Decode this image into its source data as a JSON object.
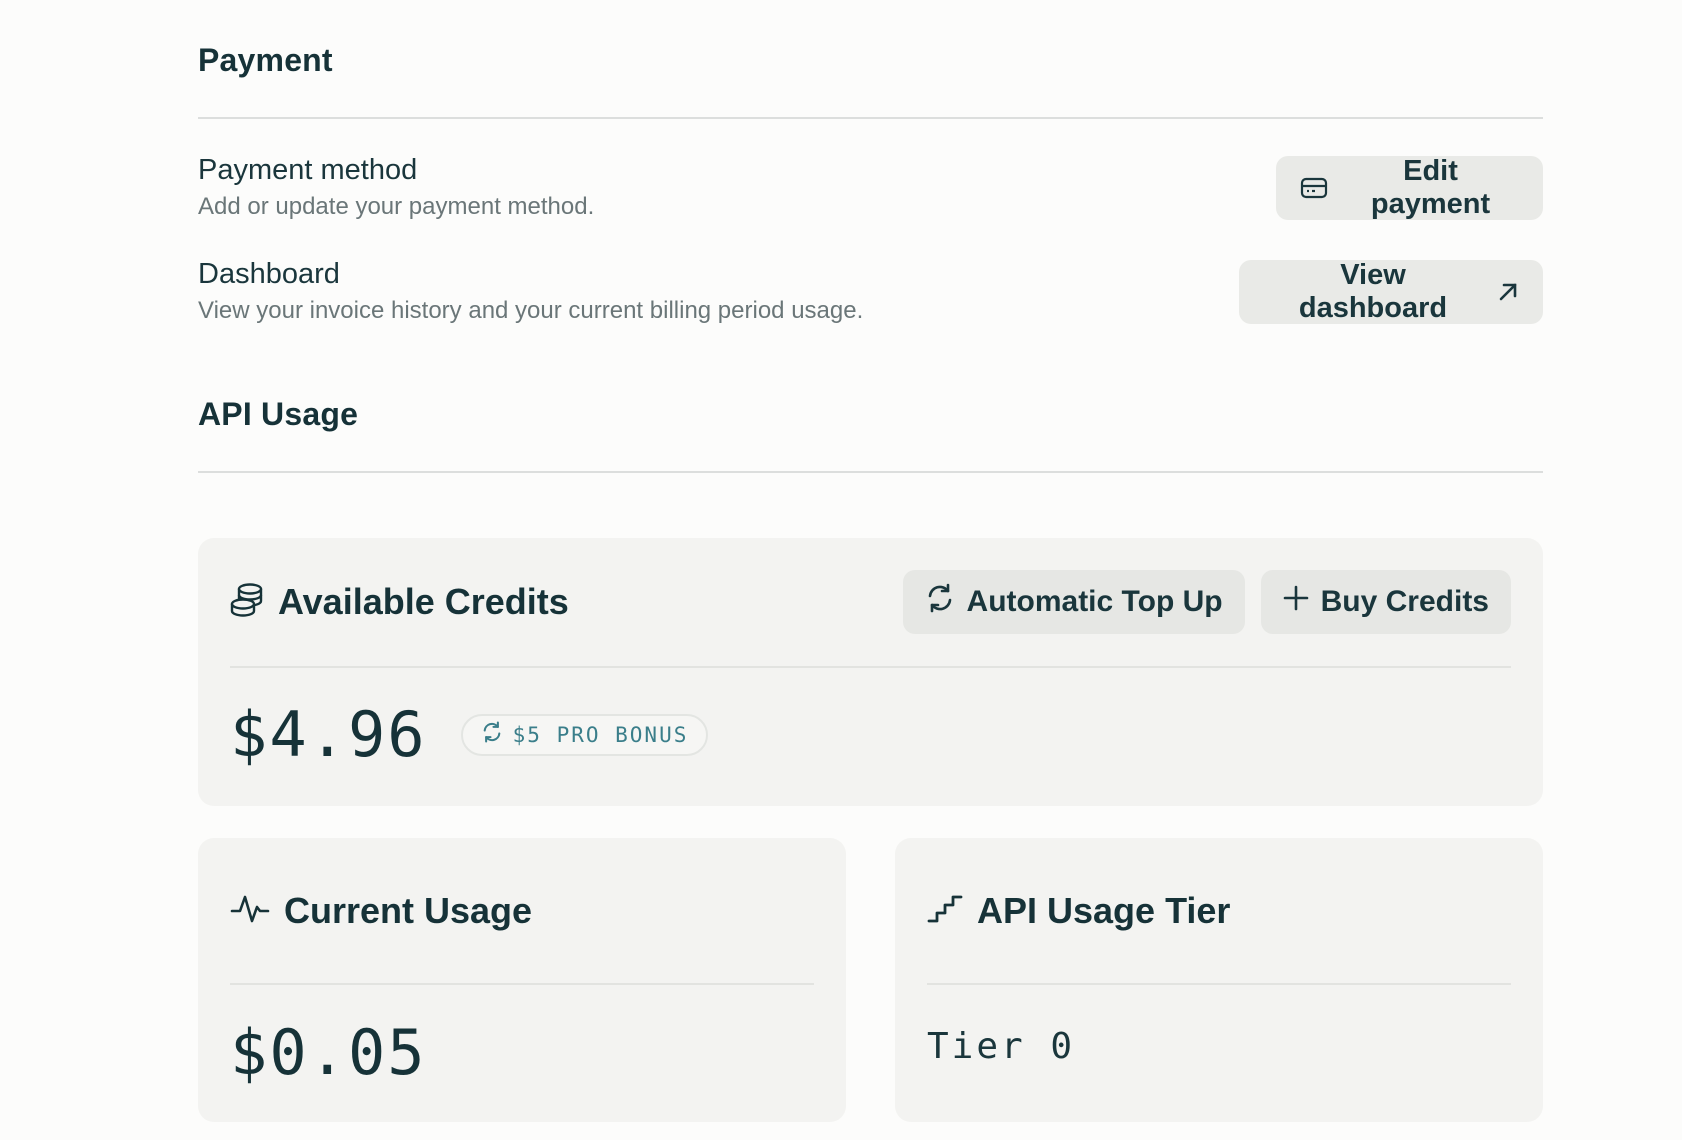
{
  "payment": {
    "section_title": "Payment",
    "method": {
      "title": "Payment method",
      "description": "Add or update your payment method.",
      "button_label": "Edit payment"
    },
    "dashboard": {
      "title": "Dashboard",
      "description": "View your invoice history and your current billing period usage.",
      "button_label": "View dashboard"
    }
  },
  "api_usage": {
    "section_title": "API Usage",
    "credits": {
      "title": "Available Credits",
      "auto_topup_label": "Automatic Top Up",
      "buy_label": "Buy Credits",
      "amount": "$4.96",
      "bonus_badge": "$5 PRO BONUS"
    },
    "current_usage": {
      "title": "Current Usage",
      "amount": "$0.05"
    },
    "tier": {
      "title": "API Usage Tier",
      "value": "Tier 0"
    }
  },
  "icons": {
    "edit_payment": "credit-card-icon",
    "view_dashboard": "arrow-up-right-icon",
    "credits": "coins-stack-icon",
    "auto_topup": "refresh-icon",
    "buy": "plus-icon",
    "bonus": "refresh-icon",
    "current_usage": "activity-pulse-icon",
    "tier": "stairs-icon"
  },
  "colors": {
    "background": "#fcfcfb",
    "card": "#f3f3f1",
    "button": "#e9eae7",
    "text": "#163238",
    "badge_text": "#3a7e8a"
  }
}
